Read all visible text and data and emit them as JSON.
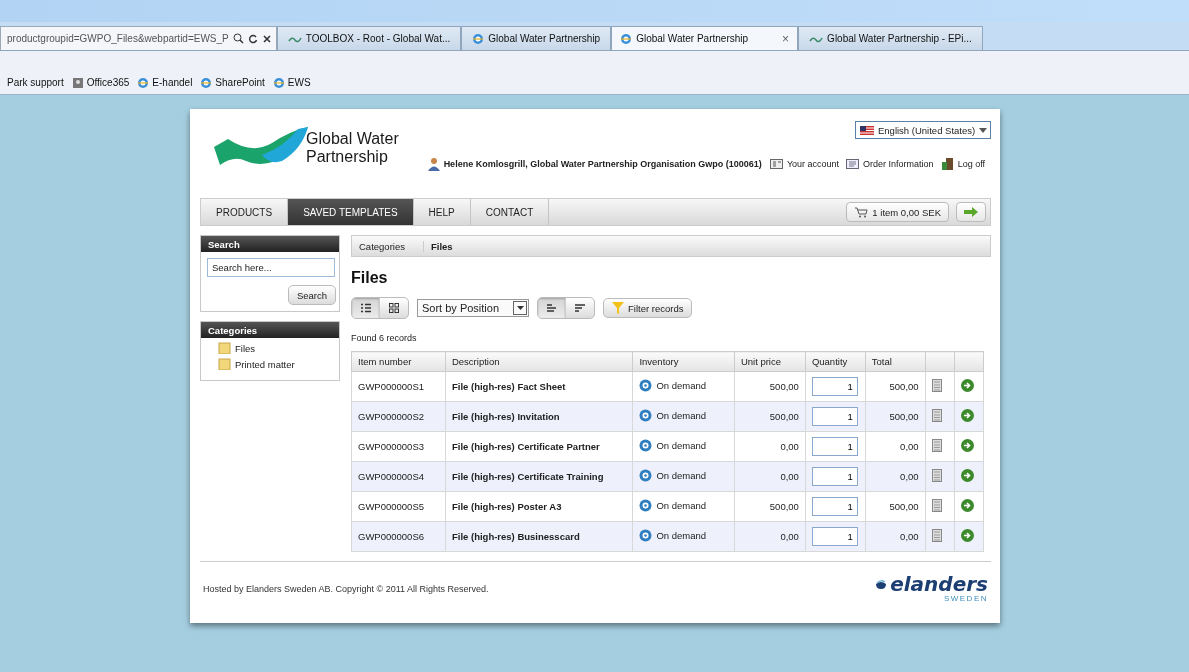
{
  "browser": {
    "address": "productgroupid=GWPO_Files&webpartid=EWS_P",
    "tabs": [
      {
        "title": "TOOLBOX - Root - Global Wat...",
        "selected": false
      },
      {
        "title": "Global Water Partnership",
        "selected": false
      },
      {
        "title": "Global Water Partnership",
        "selected": true,
        "close": "×"
      },
      {
        "title": "Global Water Partnership - EPi...",
        "selected": false
      }
    ],
    "favorites": [
      "Park support",
      "Office365",
      "E-handel",
      "SharePoint",
      "EWS"
    ]
  },
  "header": {
    "logo_line1": "Global Water",
    "logo_line2": "Partnership",
    "language": "English (United States)",
    "user": "Helene Komlosgrill, Global Water Partnership Organisation Gwpo (100061)",
    "links": [
      "Your account",
      "Order Information",
      "Log off"
    ]
  },
  "nav": {
    "items": [
      {
        "label": "PRODUCTS",
        "selected": false
      },
      {
        "label": "SAVED TEMPLATES",
        "selected": true
      },
      {
        "label": "HELP",
        "selected": false
      },
      {
        "label": "CONTACT",
        "selected": false
      }
    ],
    "cart": "1 item 0,00 SEK"
  },
  "sidebar": {
    "search": {
      "title": "Search",
      "placeholder": "Search here...",
      "button": "Search"
    },
    "categories": {
      "title": "Categories",
      "items": [
        "Files",
        "Printed matter"
      ]
    }
  },
  "breadcrumb": [
    "Categories",
    "Files"
  ],
  "page_title": "Files",
  "toolbar": {
    "view": [
      {
        "kind": "list",
        "selected": true
      },
      {
        "kind": "grid",
        "selected": false
      }
    ],
    "sort": "Sort by Position",
    "order": [
      {
        "kind": "ascending",
        "selected": true
      },
      {
        "kind": "descending",
        "selected": false
      }
    ],
    "filter": "Filter records"
  },
  "found": "Found 6 records",
  "table": {
    "columns": [
      "Item number",
      "Description",
      "Inventory",
      "Unit price",
      "Quantity",
      "Total"
    ],
    "rows": [
      {
        "item": "GWP000000S1",
        "description": "File (high-res) Fact Sheet",
        "inventory": "On demand",
        "unit_price": "500,00",
        "quantity": "1",
        "total": "500,00"
      },
      {
        "item": "GWP000000S2",
        "description": "File (high-res) Invitation",
        "inventory": "On demand",
        "unit_price": "500,00",
        "quantity": "1",
        "total": "500,00"
      },
      {
        "item": "GWP000000S3",
        "description": "File (high-res) Certificate Partner",
        "inventory": "On demand",
        "unit_price": "0,00",
        "quantity": "1",
        "total": "0,00"
      },
      {
        "item": "GWP000000S4",
        "description": "File (high-res) Certificate Training",
        "inventory": "On demand",
        "unit_price": "0,00",
        "quantity": "1",
        "total": "0,00"
      },
      {
        "item": "GWP000000S5",
        "description": "File (high-res) Poster A3",
        "inventory": "On demand",
        "unit_price": "500,00",
        "quantity": "1",
        "total": "500,00"
      },
      {
        "item": "GWP000000S6",
        "description": "File (high-res) Businesscard",
        "inventory": "On demand",
        "unit_price": "0,00",
        "quantity": "1",
        "total": "0,00"
      }
    ]
  },
  "footer": {
    "copyright": "Hosted by Elanders Sweden AB. Copyright © 2011 All Rights Reserved.",
    "brand": "elanders",
    "brand_sub": "SWEDEN"
  }
}
